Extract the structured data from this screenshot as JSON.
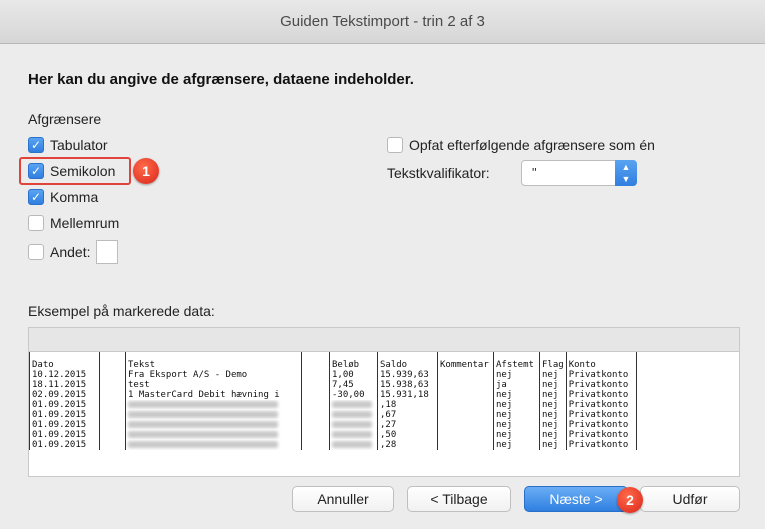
{
  "window": {
    "title": "Guiden Tekstimport - trin 2 af 3"
  },
  "heading": "Her kan du angive de afgrænsere, dataene indeholder.",
  "delimiters": {
    "label": "Afgrænsere",
    "items": [
      {
        "label": "Tabulator",
        "checked": true
      },
      {
        "label": "Semikolon",
        "checked": true
      },
      {
        "label": "Komma",
        "checked": true
      },
      {
        "label": "Mellemrum",
        "checked": false
      },
      {
        "label": "Andet:",
        "checked": false
      }
    ]
  },
  "consecutive": {
    "label": "Opfat efterfølgende afgrænsere som én",
    "checked": false
  },
  "text_qualifier": {
    "label": "Tekstkvalifikator:",
    "value": "\""
  },
  "preview": {
    "label": "Eksempel på markerede data:",
    "header": [
      "Dato",
      "",
      "Tekst",
      "",
      "Beløb",
      "Saldo",
      "Kommentar",
      "Afstemt",
      "Flag",
      "Konto",
      ""
    ],
    "rows": [
      [
        "10.12.2015",
        "",
        "Fra Eksport A/S - Demo",
        "",
        "1,00",
        "15.939,63",
        "",
        "nej",
        "nej",
        "Privatkonto",
        ""
      ],
      [
        "18.11.2015",
        "",
        "test",
        "",
        "7,45",
        "15.938,63",
        "",
        "ja",
        "nej",
        "Privatkonto",
        ""
      ],
      [
        "02.09.2015",
        "",
        "1 MasterCard Debit hævning i",
        "",
        "-30,00",
        "15.931,18",
        "",
        "nej",
        "nej",
        "Privatkonto",
        ""
      ],
      [
        "01.09.2015",
        "",
        "",
        "",
        "",
        ",18",
        "",
        "nej",
        "nej",
        "Privatkonto",
        ""
      ],
      [
        "01.09.2015",
        "",
        "",
        "",
        "",
        ",67",
        "",
        "nej",
        "nej",
        "Privatkonto",
        ""
      ],
      [
        "01.09.2015",
        "",
        "",
        "",
        "",
        ",27",
        "",
        "nej",
        "nej",
        "Privatkonto",
        ""
      ],
      [
        "01.09.2015",
        "",
        "",
        "",
        "",
        ",50",
        "",
        "nej",
        "nej",
        "Privatkonto",
        ""
      ],
      [
        "01.09.2015",
        "",
        "",
        "",
        "",
        ",28",
        "",
        "nej",
        "nej",
        "Privatkonto",
        ""
      ]
    ]
  },
  "buttons": {
    "cancel": "Annuller",
    "back": "< Tilbage",
    "next": "Næste >",
    "finish": "Udfør"
  },
  "annotations": {
    "badge1": "1",
    "badge2": "2"
  },
  "colors": {
    "accent": "#2f7fe0",
    "highlight": "#e0433a",
    "badge": "#d9251a"
  }
}
